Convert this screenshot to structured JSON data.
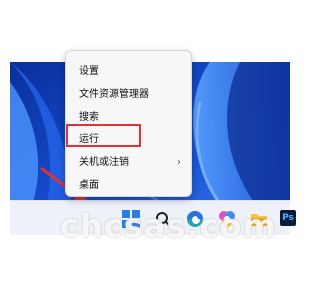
{
  "context_menu": {
    "items": [
      {
        "label": "设置"
      },
      {
        "label": "文件资源管理器"
      },
      {
        "label": "搜索"
      },
      {
        "label": "运行"
      },
      {
        "label": "关机或注销",
        "arrow": "›"
      },
      {
        "label": "桌面"
      }
    ],
    "highlighted_item": "运行"
  },
  "taskbar": {
    "icons": [
      "windows-start-icon",
      "search-icon",
      "edge-icon",
      "copilot-icon",
      "file-explorer-icon",
      "photoshop-icon"
    ],
    "photoshop_label": "Ps"
  },
  "watermark": "chcsas.com",
  "colors": {
    "accent": "#e0303a",
    "desktop_blue": "#0c3fb8",
    "menu_bg": "#f7f7f8"
  }
}
